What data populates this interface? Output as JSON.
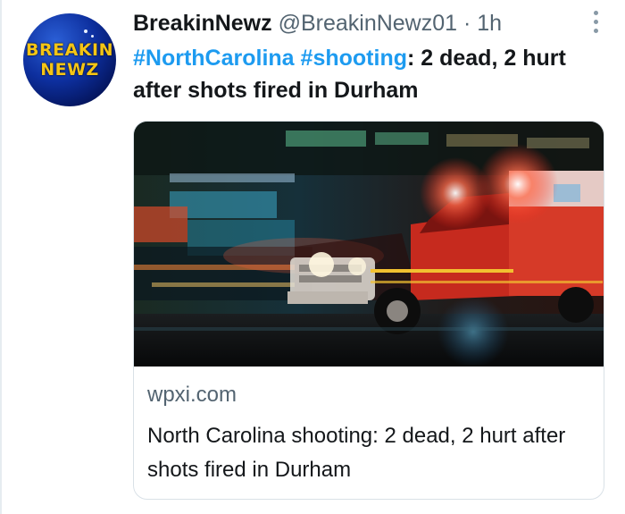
{
  "avatar": {
    "line1": "BREAKIN",
    "line2": "NEWZ"
  },
  "tweet": {
    "display_name": "BreakinNewz",
    "handle": "@BreakinNewz01",
    "separator": "·",
    "time": "1h",
    "hashtags": [
      "#NorthCarolina",
      "#shooting"
    ],
    "text_after_hashtags": ": 2 dead, 2 hurt after shots fired in Durham"
  },
  "card": {
    "domain": "wpxi.com",
    "title": "North Carolina shooting: 2 dead, 2 hurt after shots fired in Durham"
  },
  "colors": {
    "hashtag": "#1d9bf0",
    "text": "#14171a",
    "secondary": "#536471",
    "avatar_text": "#f5c515"
  },
  "icons": {
    "more": "more-vertical-icon"
  }
}
